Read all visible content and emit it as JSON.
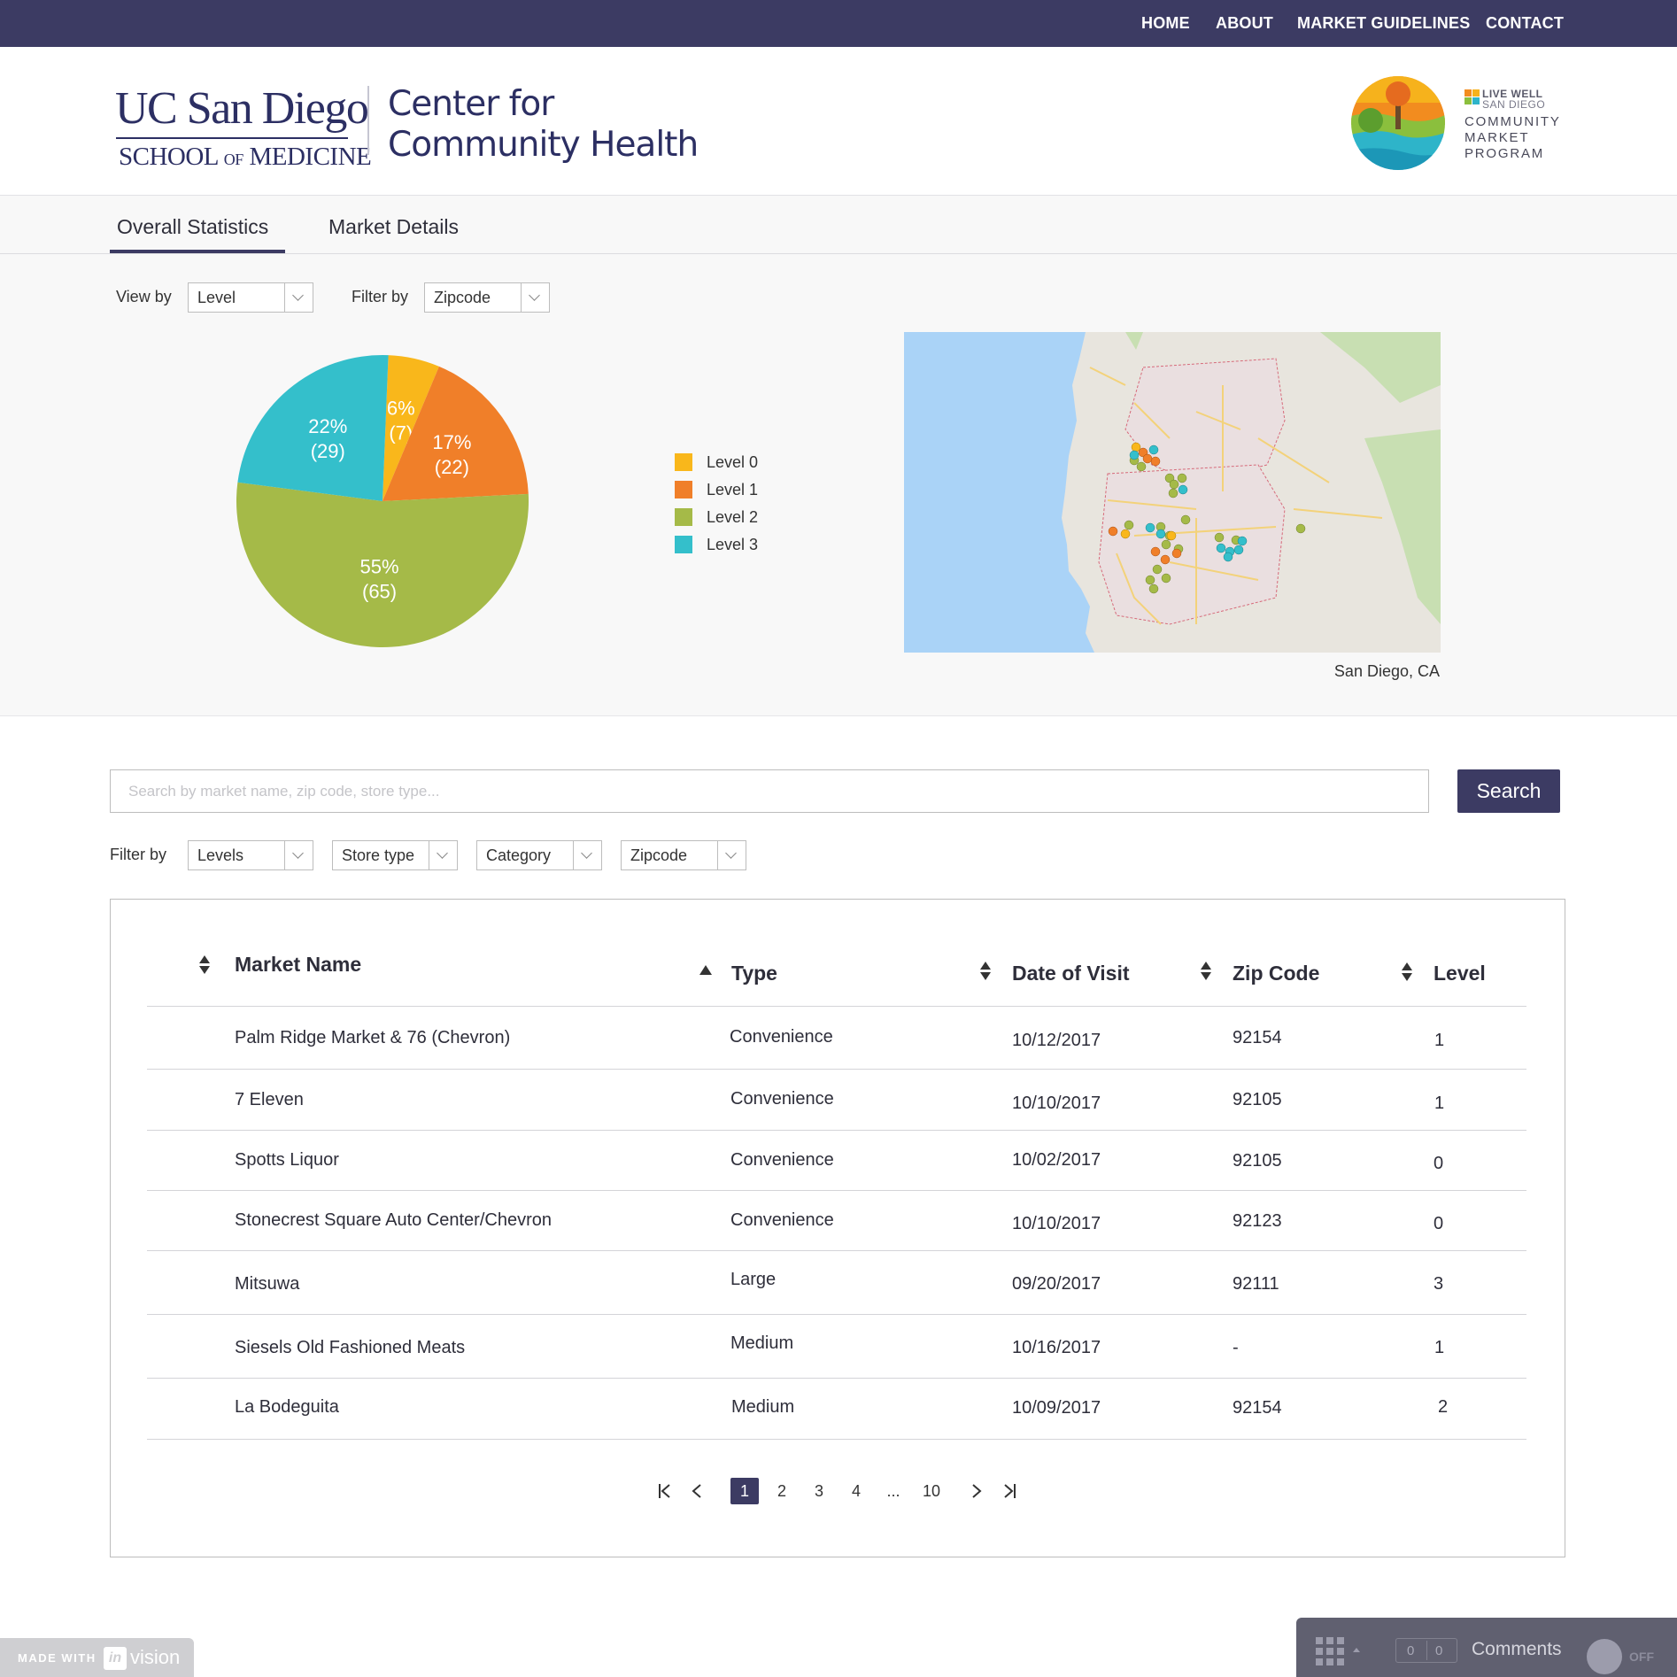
{
  "nav": {
    "items": [
      "HOME",
      "ABOUT",
      "MARKET GUIDELINES",
      "CONTACT"
    ]
  },
  "header": {
    "ucsd_line1": "UC San Diego",
    "ucsd_line2_a": "SCHOOL ",
    "ucsd_line2_b": "OF",
    "ucsd_line2_c": " MEDICINE",
    "cch_line1": "Center for",
    "cch_line2": "Community Health",
    "livewell_1": "LIVE WELL",
    "livewell_2": "SAN DIEGO",
    "cmp_1": "COMMUNITY",
    "cmp_2": "MARKET",
    "cmp_3": "PROGRAM"
  },
  "tabs": [
    {
      "label": "Overall Statistics",
      "active": true
    },
    {
      "label": "Market Details",
      "active": false
    }
  ],
  "stats": {
    "view_by_label": "View by",
    "view_by_value": "Level",
    "filter_by_label": "Filter by",
    "filter_by_value": "Zipcode",
    "map_caption": "San Diego, CA"
  },
  "chart_data": {
    "type": "pie",
    "categories": [
      "Level 0",
      "Level 1",
      "Level 2",
      "Level 3"
    ],
    "values": [
      7,
      22,
      65,
      29
    ],
    "percent_labels": [
      "6%",
      "17%",
      "55%",
      "22%"
    ],
    "count_labels": [
      "(7)",
      "(22)",
      "(65)",
      "(29)"
    ],
    "colors": [
      "#f9b71b",
      "#f07f29",
      "#a5ba48",
      "#34bfcb"
    ],
    "legend_placement": "right"
  },
  "search": {
    "placeholder": "Search by market name, zip code, store type...",
    "button_label": "Search",
    "filter_label": "Filter by",
    "filters": [
      "Levels",
      "Store type",
      "Category",
      "Zipcode"
    ]
  },
  "table": {
    "columns": [
      "Market Name",
      "Type",
      "Date of Visit",
      "Zip Code",
      "Level"
    ],
    "rows": [
      {
        "name": "Palm Ridge Market & 76 (Chevron)",
        "type": "Convenience",
        "date": "10/12/2017",
        "zip": "92154",
        "level": "1"
      },
      {
        "name": "7 Eleven",
        "type": "Convenience",
        "date": "10/10/2017",
        "zip": "92105",
        "level": "1"
      },
      {
        "name": "Spotts Liquor",
        "type": "Convenience",
        "date": "10/02/2017",
        "zip": "92105",
        "level": "0"
      },
      {
        "name": "Stonecrest Square Auto Center/Chevron",
        "type": "Convenience",
        "date": "10/10/2017",
        "zip": "92123",
        "level": "0"
      },
      {
        "name": "Mitsuwa",
        "type": "Large",
        "date": "09/20/2017",
        "zip": "92111",
        "level": "3"
      },
      {
        "name": "Siesels Old Fashioned Meats",
        "type": "Medium",
        "date": "10/16/2017",
        "zip": "-",
        "level": "1"
      },
      {
        "name": "La Bodeguita",
        "type": "Medium",
        "date": "10/09/2017",
        "zip": "92154",
        "level": "2"
      }
    ]
  },
  "pagination": {
    "pages": [
      "1",
      "2",
      "3",
      "4",
      "...",
      "10"
    ],
    "current": "1"
  },
  "invision": {
    "made_with": "MADE WITH",
    "in_mark": "in",
    "vision": "vision",
    "count_a": "0",
    "count_b": "0",
    "comments_label": "Comments",
    "toggle_label": "OFF"
  }
}
